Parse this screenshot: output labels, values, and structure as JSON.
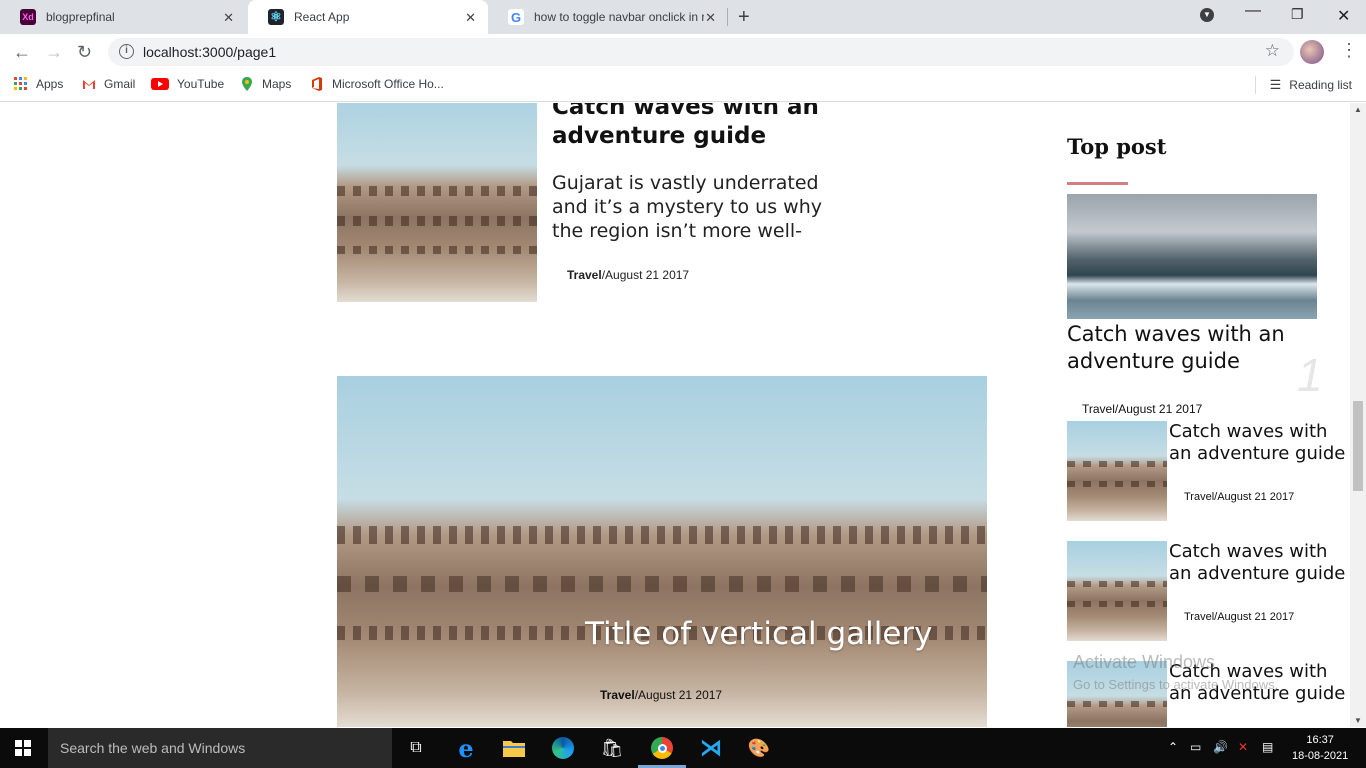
{
  "browser": {
    "tabs": [
      {
        "title": "blogprepfinal",
        "icon": "adobe-xd-icon",
        "color": "#470137"
      },
      {
        "title": "React App",
        "icon": "react-icon",
        "color": "#61dafb"
      },
      {
        "title": "how to toggle navbar onclick in r",
        "icon": "google-icon",
        "color": "#4285f4"
      }
    ],
    "url": "localhost:3000/page1",
    "bookmarks": [
      {
        "label": "Apps",
        "icon": "apps-grid-icon"
      },
      {
        "label": "Gmail",
        "icon": "gmail-icon"
      },
      {
        "label": "YouTube",
        "icon": "youtube-icon"
      },
      {
        "label": "Maps",
        "icon": "maps-pin-icon"
      },
      {
        "label": "Microsoft Office Ho...",
        "icon": "office-icon"
      }
    ],
    "reading_list": "Reading list"
  },
  "post1": {
    "title": "Catch waves with an adventure guide",
    "excerpt": "Gujarat is vastly underrated and it’s a mystery to us why the region isn’t more well-",
    "category": "Travel",
    "date": "/August 21 2017"
  },
  "hero": {
    "title": "Title of vertical gallery",
    "category": "Travel",
    "date": "/August 21 2017"
  },
  "sidebar": {
    "heading": "Top post",
    "top": {
      "title": "Catch waves with an adventure guide",
      "rank": "1",
      "meta": "Travel/August 21 2017"
    },
    "items": [
      {
        "title": "Catch waves with an adventure guide",
        "meta": "Travel/August 21 2017"
      },
      {
        "title": "Catch waves with an adventure guide",
        "meta": "Travel/August 21 2017"
      },
      {
        "title": "Catch waves with an adventure guide",
        "meta": ""
      }
    ]
  },
  "watermark": {
    "line1": "Activate Windows",
    "line2": "Go to Settings to activate Windows."
  },
  "taskbar": {
    "search_placeholder": "Search the web and Windows",
    "time": "16:37",
    "date": "18-08-2021"
  }
}
